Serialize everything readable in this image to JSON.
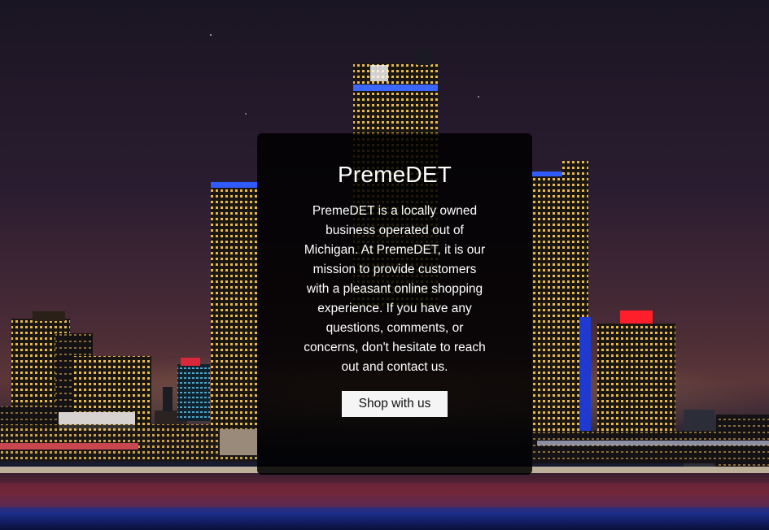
{
  "hero": {
    "title": "PremeDET",
    "description": "PremeDET is a locally owned business operated out of Michigan. At PremeDET, it is our mission to provide customers with a pleasant online shopping experience. If you have any questions, comments, or concerns, don't hesitate to reach out and contact us.",
    "button_label": "Shop with us"
  },
  "colors": {
    "panel_background": "#000000",
    "button_background": "#f5f5f5",
    "accent_blue": "#2a5bff",
    "window_light": "#f2c65a"
  }
}
